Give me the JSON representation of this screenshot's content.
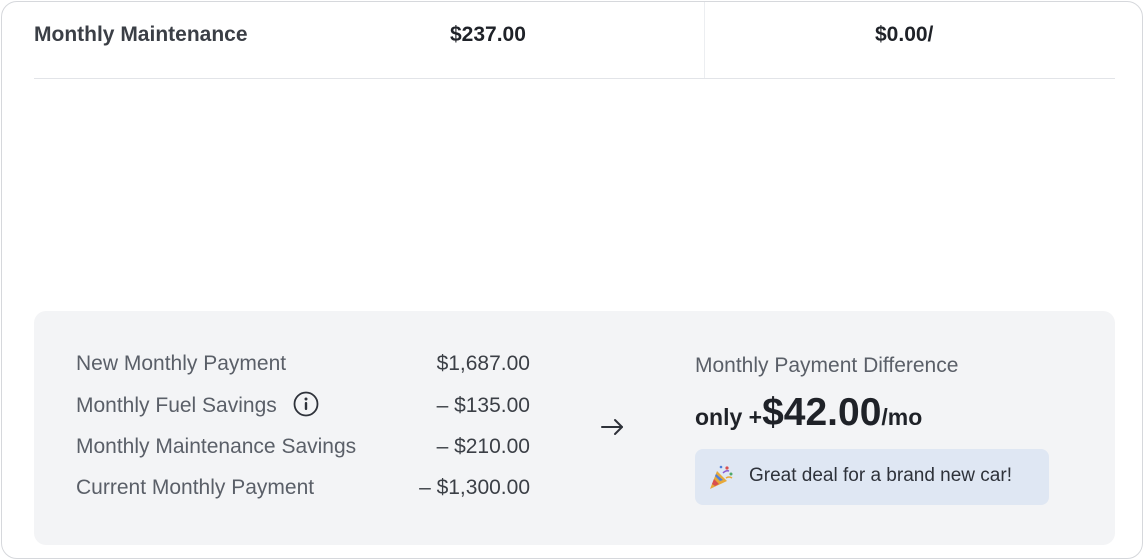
{
  "table": {
    "row_label": "Monthly Maintenance",
    "value_a": "$237.00",
    "value_b": "$0.00/"
  },
  "summary": {
    "lines": [
      {
        "label": "New Monthly Payment",
        "value": "$1,687.00"
      },
      {
        "label": "Monthly Fuel Savings",
        "value": "– $135.00"
      },
      {
        "label": "Monthly Maintenance Savings",
        "value": "– $210.00"
      },
      {
        "label": "Current Monthly Payment",
        "value": "– $1,300.00"
      }
    ],
    "info_icon": "info-circle-icon",
    "arrow_icon": "arrow-right-icon",
    "difference": {
      "title": "Monthly Payment Difference",
      "prefix": "only +",
      "amount": "$42.00",
      "suffix": "/mo"
    },
    "badge": {
      "icon": "party-popper-icon",
      "text": "Great deal for a brand new car!"
    }
  },
  "colors": {
    "summary_bg": "#f3f4f6",
    "badge_bg": "#dfe7f3",
    "text_primary": "#1f2228",
    "text_secondary": "#5a5f68"
  }
}
